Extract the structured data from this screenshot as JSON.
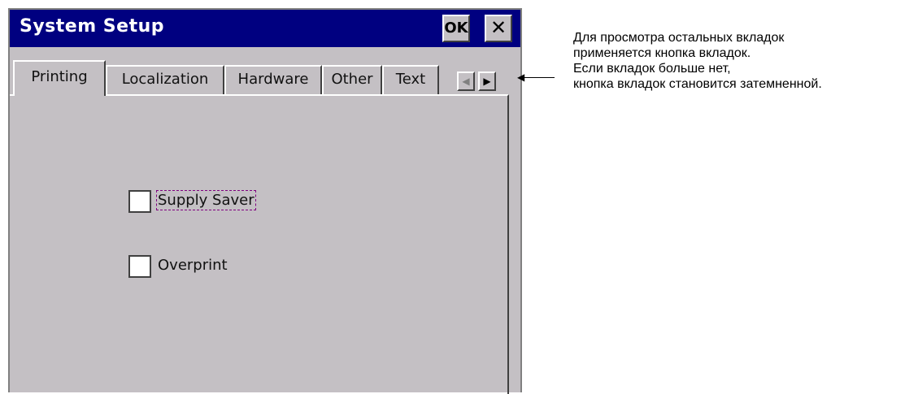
{
  "window": {
    "title": "System Setup",
    "ok_label": "OK",
    "close_label": "✕"
  },
  "tabs": [
    {
      "label": "Printing",
      "active": true
    },
    {
      "label": "Localization",
      "active": false
    },
    {
      "label": "Hardware",
      "active": false
    },
    {
      "label": "Other",
      "active": false
    },
    {
      "label": "Text",
      "active": false
    }
  ],
  "tab_scroll": {
    "left": "◀",
    "right": "▶"
  },
  "options": [
    {
      "label": "Supply Saver",
      "checked": false,
      "focused": true
    },
    {
      "label": "Overprint",
      "checked": false,
      "focused": false
    }
  ],
  "annotation": {
    "line1": "Для просмотра остальных вкладок",
    "line2": "применяется кнопка вкладок.",
    "line3": "Если вкладок больше нет,",
    "line4": "кнопка вкладок становится затемненной."
  },
  "colors": {
    "titlebar": "#000080",
    "window_bg": "#c4c0c4"
  }
}
